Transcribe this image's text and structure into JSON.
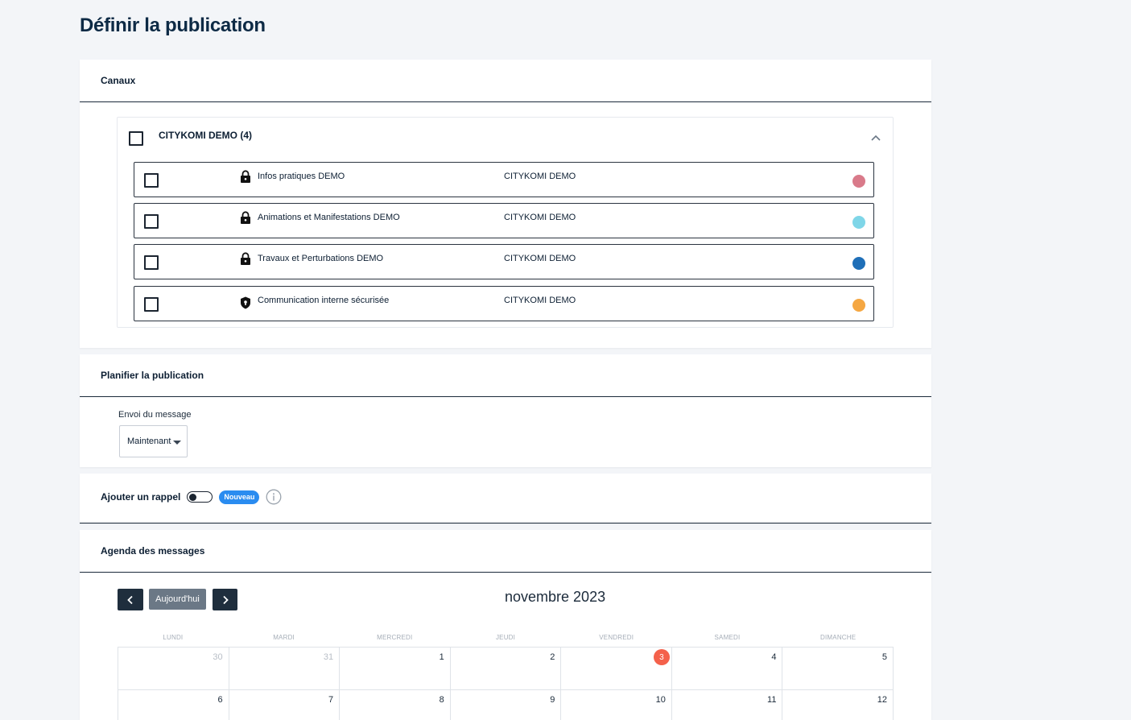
{
  "page": {
    "title": "Définir la publication"
  },
  "canaux": {
    "header": "Canaux",
    "group_label": "CITYKOMI DEMO (4)",
    "channels": [
      {
        "name": "Infos pratiques DEMO",
        "org": "CITYKOMI DEMO",
        "icon": "lock-icon",
        "color": "#d97a8a"
      },
      {
        "name": "Animations et Manifestations DEMO",
        "org": "CITYKOMI DEMO",
        "icon": "lock-icon",
        "color": "#7fd6e8"
      },
      {
        "name": "Travaux et Perturbations DEMO",
        "org": "CITYKOMI DEMO",
        "icon": "lock-icon",
        "color": "#1f6fb8"
      },
      {
        "name": "Communication interne sécurisée",
        "org": "CITYKOMI DEMO",
        "icon": "shield-lock-icon",
        "color": "#f5a742"
      }
    ]
  },
  "planifier": {
    "header": "Planifier la publication",
    "field_label": "Envoi du message",
    "select_value": "Maintenant"
  },
  "rappel": {
    "label": "Ajouter un rappel",
    "badge": "Nouveau"
  },
  "agenda": {
    "header": "Agenda des messages",
    "today_label": "Aujourd'hui",
    "title": "novembre 2023",
    "weekdays": [
      "LUNDI",
      "MARDI",
      "MERCREDI",
      "JEUDI",
      "VENDREDI",
      "SAMEDI",
      "DIMANCHE"
    ],
    "weeks": [
      [
        "30",
        "31",
        "1",
        "2",
        "3",
        "4",
        "5"
      ],
      [
        "6",
        "7",
        "8",
        "9",
        "10",
        "11",
        "12"
      ]
    ],
    "today_day": "3"
  }
}
